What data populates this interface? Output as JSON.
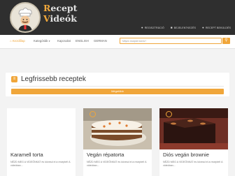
{
  "brand": {
    "line1": "Recept",
    "line1_highlight": "R",
    "line2": "Videók",
    "line2_highlight": "V",
    "accent": "#f2a93b"
  },
  "top_links": [
    {
      "label": "REGISZTRÁCIÓ",
      "icon": "user-icon"
    },
    {
      "label": "BEJELENTKEZÉS",
      "icon": "lock-icon"
    },
    {
      "label": "RECEPT BEKÜLDÉS",
      "icon": "user-icon"
    }
  ],
  "nav": {
    "home": "Kezdőlap",
    "categories": "Kategóriák",
    "contact": "Kapcsolat",
    "english": "ENGLISH",
    "german": "GERMAN",
    "search_placeholder": "Milyen receptet keres?"
  },
  "section": {
    "title": "Legfrissebb receptek",
    "more_button": "Mégetöbb"
  },
  "cards": [
    {
      "title": "Karamell torta",
      "sub": "NÉZD MEG A VIDEÓNKAT és kövesd el a receptet! A videóban..."
    },
    {
      "title": "Vegán répatorta",
      "sub": "NÉZD MEG A VIDEÓNKAT és kövesd el a receptet! A videóban..."
    },
    {
      "title": "Diós vegán brownie",
      "sub": "NÉZD MEG A VIDEÓNKAT és kövesd el a receptet! A videóban..."
    }
  ],
  "colors": {
    "header_bg": "#2f2f2f",
    "accent": "#f0a63a"
  }
}
